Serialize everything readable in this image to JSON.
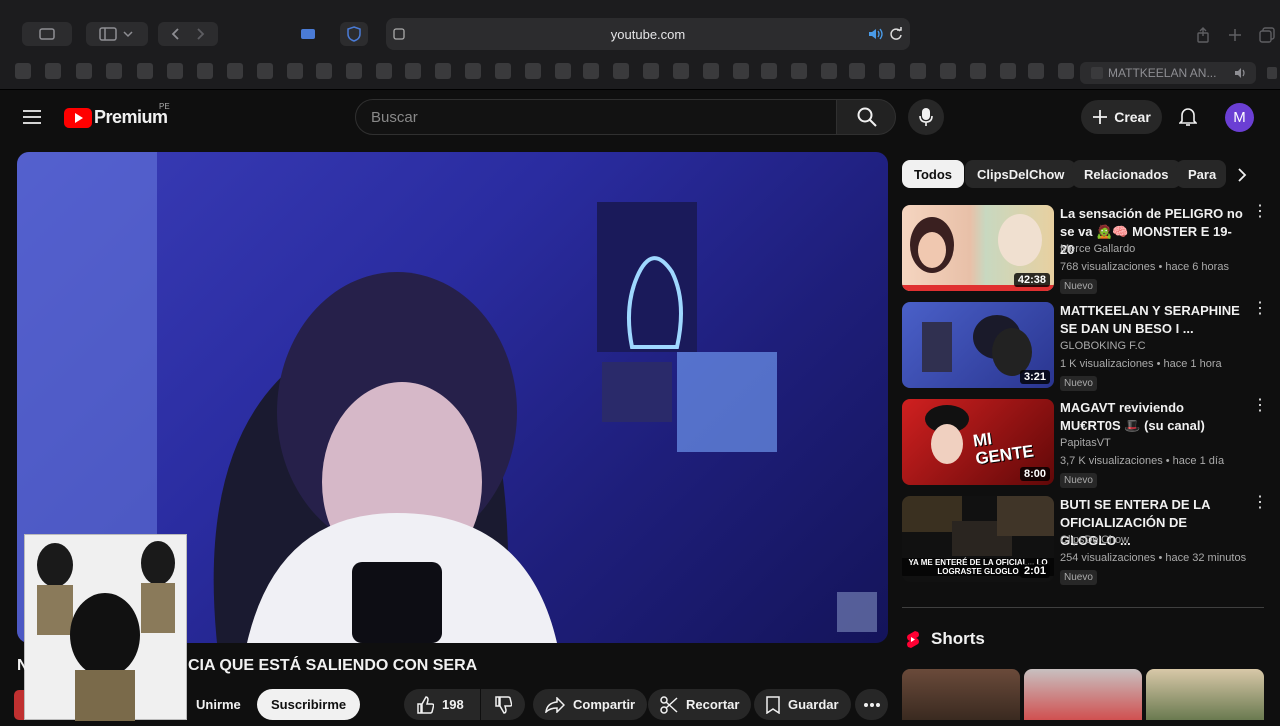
{
  "browser": {
    "url": "youtube.com",
    "tab_title": "MATTKEELAN AN..."
  },
  "header": {
    "logo_text": "Premium",
    "region": "PE",
    "search_placeholder": "Buscar",
    "create_label": "Crear",
    "avatar_letter": "M"
  },
  "video": {
    "title": "CIA QUE ESTÁ SALIENDO CON SERA",
    "title_prefix": "N",
    "join_label": "Unirme",
    "subscribe_label": "Suscribirme",
    "likes": "198",
    "share_label": "Compartir",
    "clip_label": "Recortar",
    "save_label": "Guardar"
  },
  "chips": [
    "Todos",
    "ClipsDelChow",
    "Relacionados",
    "Para"
  ],
  "recommendations": [
    {
      "title": "La sensación de PELIGRO no se va 🧟🧠 MONSTER E 19-20",
      "channel": "Merce Gallardo",
      "meta": "768 visualizaciones • hace 6 horas",
      "duration": "42:38",
      "badge": "Nuevo"
    },
    {
      "title": "MATTKEELAN Y SERAPHINE SE DAN UN BESO I ...",
      "channel": "GLOBOKING F.C",
      "meta": "1 K visualizaciones • hace 1 hora",
      "duration": "3:21",
      "badge": "Nuevo"
    },
    {
      "title": "MAGAVT reviviendo MU€RT0S 🎩 (su canal)",
      "channel": "PapitasVT",
      "meta": "3,7 K visualizaciones • hace 1 día",
      "duration": "8:00",
      "badge": "Nuevo"
    },
    {
      "title": "BUTI SE ENTERA DE LA OFICIALIZACIÓN DE GLOGLO ...",
      "channel": "ClipsDelChow",
      "meta": "254 visualizaciones • hace 32 minutos",
      "duration": "2:01",
      "badge": "Nuevo"
    }
  ],
  "thumb_texts": {
    "thumb3": "MI GENTE",
    "thumb4": "YA ME ENTERÉ DE LA OFICIAL... LO LOGRASTE GLOGLO"
  },
  "shorts_label": "Shorts",
  "colors": {
    "accent": "#ff0000",
    "avatar": "#6b3fd4",
    "bg": "#0f0f0f"
  }
}
